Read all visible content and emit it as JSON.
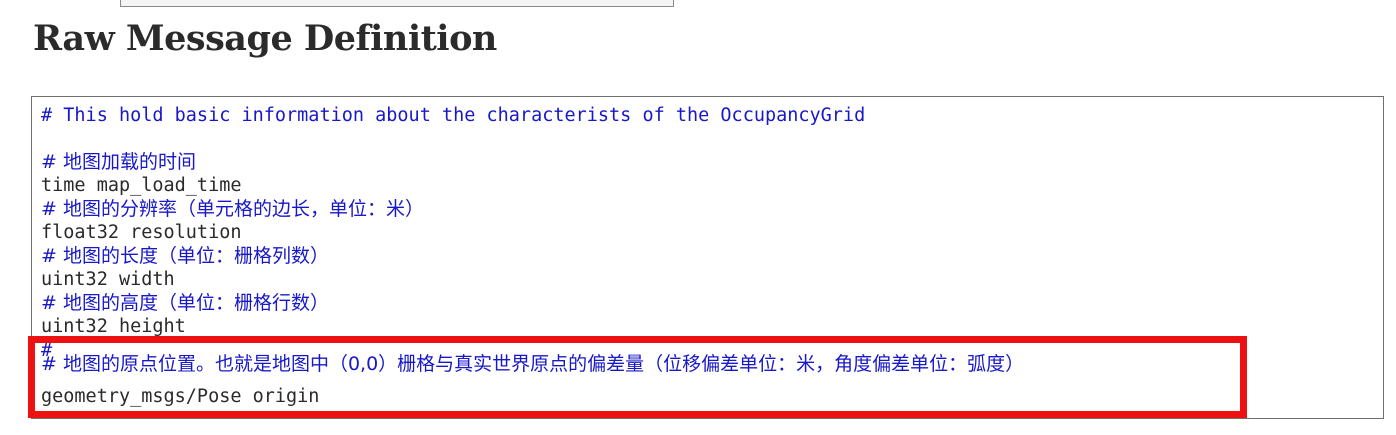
{
  "section": {
    "title": "Raw Message Definition"
  },
  "code": {
    "lines": [
      {
        "kind": "comment",
        "text": "# This hold basic information about the characterists of the OccupancyGrid"
      },
      {
        "kind": "comment",
        "text": "# 地图加载的时间"
      },
      {
        "kind": "decl",
        "text": "time map_load_time"
      },
      {
        "kind": "comment",
        "text": "# 地图的分辨率（单元格的边长，单位：米）"
      },
      {
        "kind": "decl",
        "text": "float32 resolution"
      },
      {
        "kind": "comment",
        "text": "# 地图的长度（单位：栅格列数）"
      },
      {
        "kind": "decl",
        "text": "uint32 width"
      },
      {
        "kind": "comment",
        "text": "# 地图的高度（单位：栅格行数）"
      },
      {
        "kind": "decl",
        "text": "uint32 height"
      },
      {
        "kind": "comment",
        "text": "#"
      },
      {
        "kind": "comment",
        "text": "# 地图的原点位置。也就是地图中（0,0）栅格与真实世界原点的偏差量（位移偏差单位：米，角度偏差单位：弧度）"
      },
      {
        "kind": "decl",
        "text": "geometry_msgs/Pose origin"
      }
    ]
  },
  "colors": {
    "comment": "#1818c8",
    "declaration": "#2a2a2a",
    "highlight": "#ee1111"
  }
}
